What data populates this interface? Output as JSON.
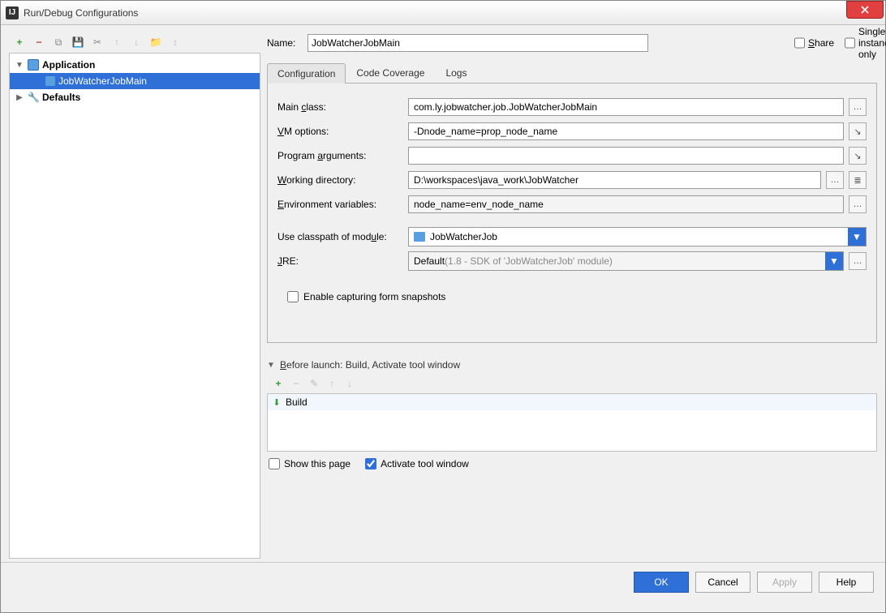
{
  "window": {
    "title": "Run/Debug Configurations"
  },
  "tree": {
    "application": "Application",
    "selected_config": "JobWatcherJobMain",
    "defaults": "Defaults"
  },
  "name": {
    "label": "Name:",
    "value": "JobWatcherJobMain"
  },
  "share": {
    "label": "Share",
    "checked": false
  },
  "single_instance": {
    "label": "Single instance only",
    "checked": false
  },
  "tabs": {
    "configuration": "Configuration",
    "code_coverage": "Code Coverage",
    "logs": "Logs"
  },
  "form": {
    "main_class": {
      "label": "Main class:",
      "value": "com.ly.jobwatcher.job.JobWatcherJobMain"
    },
    "vm_options": {
      "label": "VM options:",
      "value": "-Dnode_name=prop_node_name"
    },
    "program_args": {
      "label": "Program arguments:",
      "value": ""
    },
    "working_dir": {
      "label": "Working directory:",
      "value": "D:\\workspaces\\java_work\\JobWatcher"
    },
    "env_vars": {
      "label": "Environment variables:",
      "value": "node_name=env_node_name"
    },
    "classpath": {
      "label": "Use classpath of module:",
      "value": "JobWatcherJob"
    },
    "jre": {
      "label": "JRE:",
      "value": "Default ",
      "hint": "(1.8 - SDK of 'JobWatcherJob' module)"
    },
    "snapshots": {
      "label": "Enable capturing form snapshots",
      "checked": false
    }
  },
  "before_launch": {
    "header": "Before launch: Build, Activate tool window",
    "item": "Build",
    "show_page": {
      "label": "Show this page",
      "checked": false
    },
    "activate_tw": {
      "label": "Activate tool window",
      "checked": true
    }
  },
  "buttons": {
    "ok": "OK",
    "cancel": "Cancel",
    "apply": "Apply",
    "help": "Help"
  }
}
